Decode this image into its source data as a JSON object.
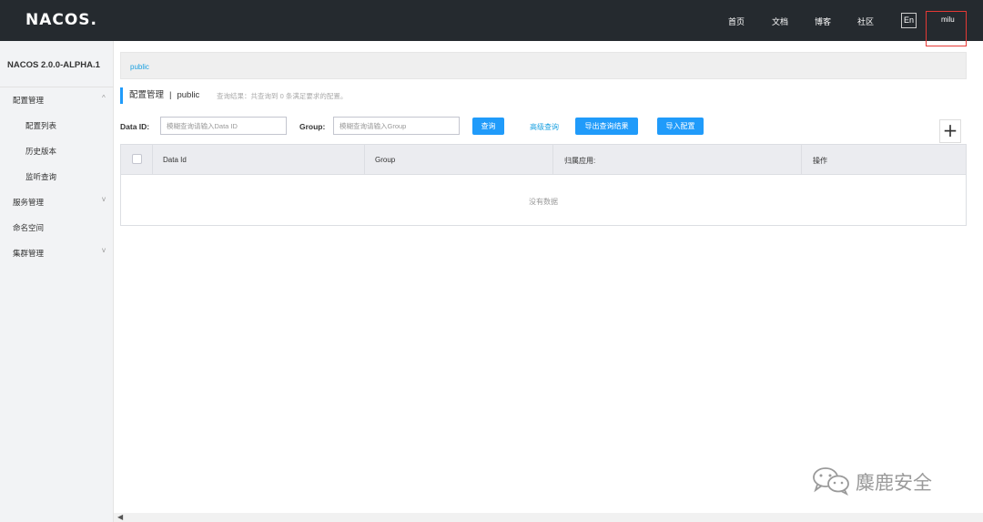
{
  "header": {
    "logo": "NACOS.",
    "nav": [
      "首页",
      "文档",
      "博客",
      "社区"
    ],
    "lang": "En",
    "user": "milu"
  },
  "sidebar": {
    "title": "NACOS 2.0.0-ALPHA.1",
    "sections": [
      {
        "label": "配置管理",
        "expanded": true,
        "chevron": "^",
        "children": [
          "配置列表",
          "历史版本",
          "监听查询"
        ]
      },
      {
        "label": "服务管理",
        "chevron": "v"
      },
      {
        "label": "命名空间"
      },
      {
        "label": "集群管理",
        "chevron": "v"
      }
    ]
  },
  "namespace_bar": {
    "current": "public"
  },
  "page": {
    "title": "配置管理",
    "separator": "|",
    "namespace": "public",
    "result_text": "查询结果：共查询到 0 条满足要求的配置。"
  },
  "filters": {
    "data_id_label": "Data ID:",
    "data_id_placeholder": "模糊查询请输入Data ID",
    "group_label": "Group:",
    "group_placeholder": "模糊查询请输入Group",
    "query_button": "查询",
    "advanced_link": "高级查询",
    "export_button": "导出查询结果",
    "import_button": "导入配置",
    "add_button": "+"
  },
  "table": {
    "columns": [
      "Data Id",
      "Group",
      "归属应用:",
      "操作"
    ],
    "empty_text": "没有数据"
  },
  "watermark": {
    "text": "麋鹿安全"
  },
  "colors": {
    "topbar": "#252a2f",
    "accent": "#209bfa",
    "link": "#1aa0e0",
    "highlight": "#e53935"
  }
}
